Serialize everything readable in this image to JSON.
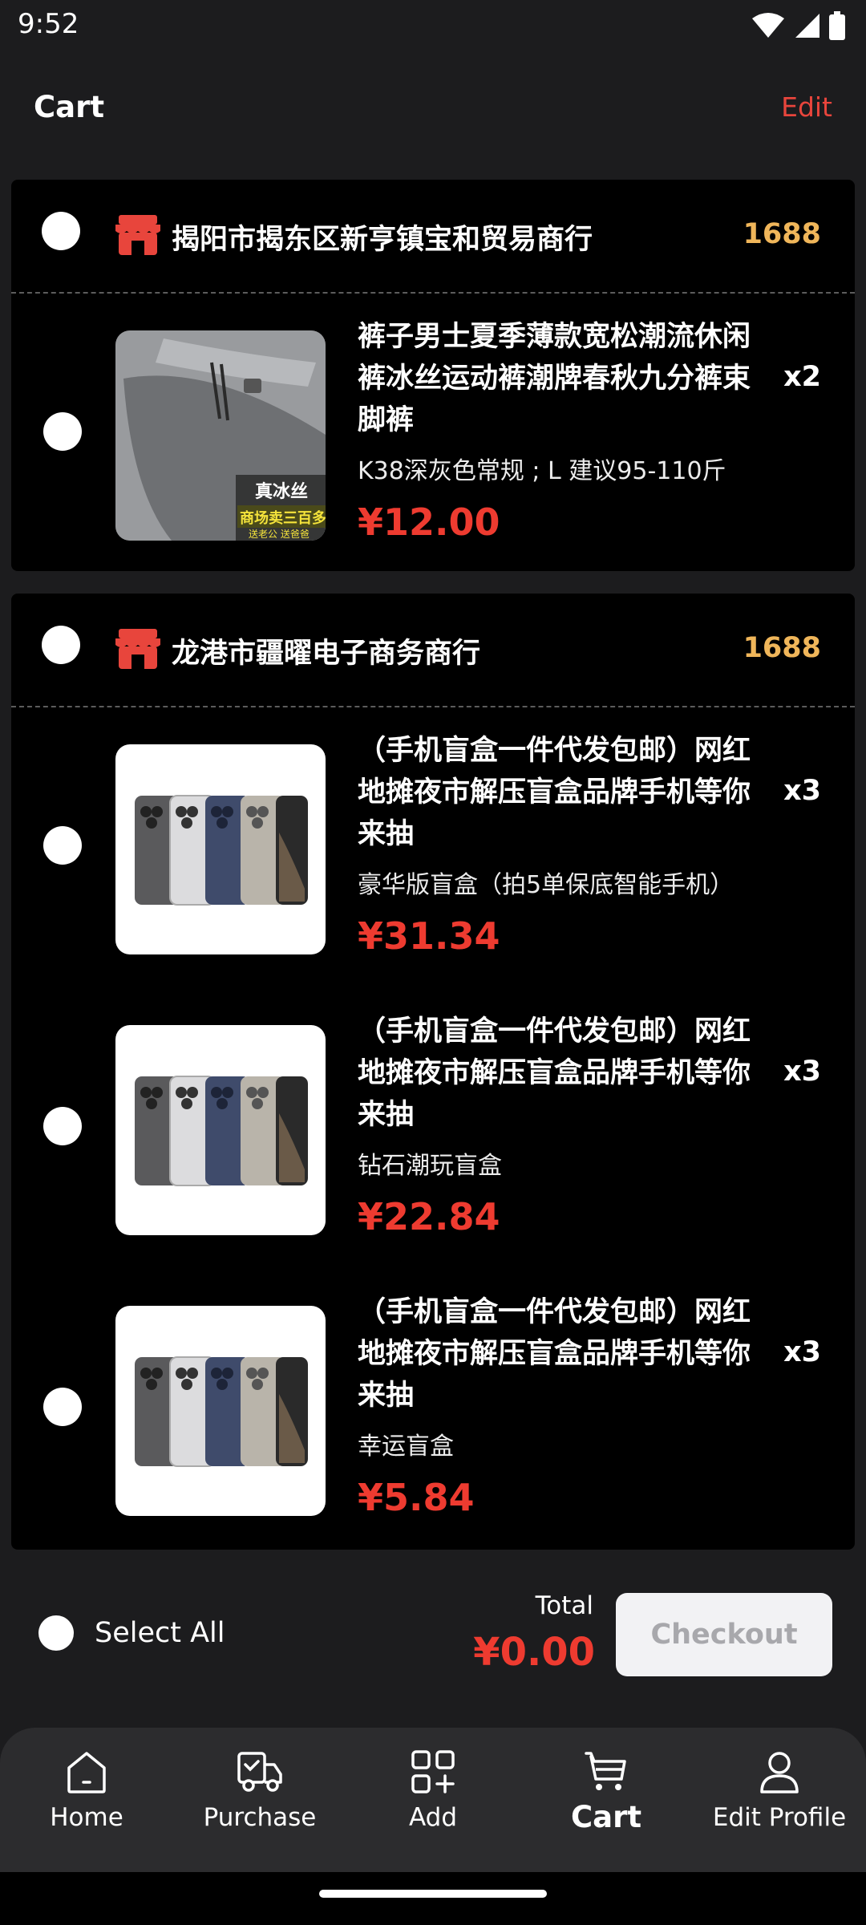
{
  "status_bar": {
    "time": "9:52"
  },
  "header": {
    "title": "Cart",
    "edit_label": "Edit"
  },
  "shops": [
    {
      "name": "揭阳市揭东区新亨镇宝和贸易商行",
      "source": "1688",
      "items": [
        {
          "title": "裤子男士夏季薄款宽松潮流休闲裤冰丝运动裤潮牌春秋九分裤束脚裤",
          "variant": "K38深灰色常规 ; L 建议95-110斤",
          "price": "¥12.00",
          "qty": "x2",
          "image_text_1": "真冰丝",
          "image_text_2": "商场卖三百多",
          "image_text_3": "送老公 送爸爸"
        }
      ]
    },
    {
      "name": "龙港市疆曜电子商务商行",
      "source": "1688",
      "items": [
        {
          "title": "（手机盲盒一件代发包邮）网红地摊夜市解压盲盒品牌手机等你来抽",
          "variant": "豪华版盲盒（拍5单保底智能手机）",
          "price": "¥31.34",
          "qty": "x3"
        },
        {
          "title": "（手机盲盒一件代发包邮）网红地摊夜市解压盲盒品牌手机等你来抽",
          "variant": "钻石潮玩盲盒",
          "price": "¥22.84",
          "qty": "x3"
        },
        {
          "title": "（手机盲盒一件代发包邮）网红地摊夜市解压盲盒品牌手机等你来抽",
          "variant": "幸运盲盒",
          "price": "¥5.84",
          "qty": "x3"
        }
      ]
    }
  ],
  "footer": {
    "select_all_label": "Select All",
    "total_label": "Total",
    "total_value": "¥0.00",
    "checkout_label": "Checkout"
  },
  "nav": {
    "home": "Home",
    "purchase": "Purchase",
    "add": "Add",
    "cart": "Cart",
    "edit_profile": "Edit Profile",
    "active": "cart"
  },
  "colors": {
    "accent_red": "#ee3b30",
    "source_gold": "#f0b65a",
    "store_icon_red": "#e8453c"
  },
  "icons": [
    "wifi-icon",
    "signal-icon",
    "battery-icon",
    "store-icon",
    "home-icon",
    "truck-icon",
    "add-grid-icon",
    "cart-icon",
    "profile-icon"
  ]
}
